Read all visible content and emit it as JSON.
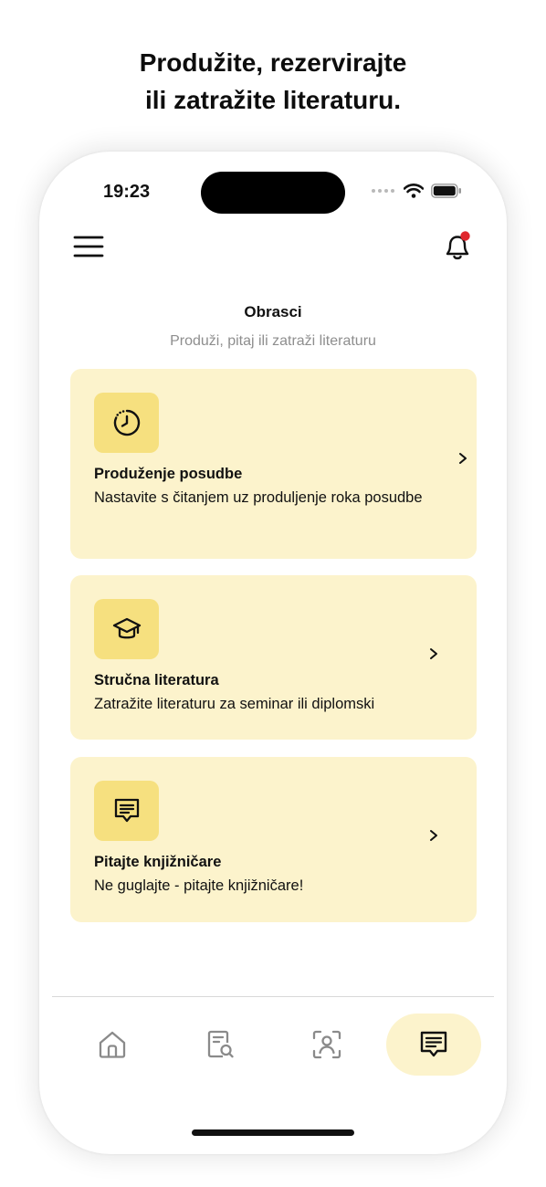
{
  "headline": {
    "line1": "Produžite, rezervirajte",
    "line2": "ili zatražite literaturu."
  },
  "status_bar": {
    "time": "19:23"
  },
  "header": {
    "menu_icon": "hamburger-menu-icon",
    "notification_icon": "bell-icon",
    "notification_badge_color": "#e0272d"
  },
  "page": {
    "title": "Obrasci",
    "subtitle": "Produži, pitaj ili zatraži literaturu"
  },
  "cards": [
    {
      "icon": "timer-clock-icon",
      "title": "Produženje posudbe",
      "description": "Nastavite s čitanjem uz produljenje roka posudbe"
    },
    {
      "icon": "graduation-cap-icon",
      "title": "Stručna literatura",
      "description": "Zatražite literaturu za seminar ili diplomski"
    },
    {
      "icon": "message-icon",
      "title": "Pitajte knjižničare",
      "description": "Ne guglajte - pitajte knjižničare!"
    }
  ],
  "tab_bar": {
    "items": [
      {
        "icon": "home-icon",
        "active": false
      },
      {
        "icon": "document-search-icon",
        "active": false
      },
      {
        "icon": "scan-user-icon",
        "active": false
      },
      {
        "icon": "message-icon",
        "active": true
      }
    ]
  },
  "colors": {
    "card_background": "#fcf3cc",
    "icon_background": "#f6e07f",
    "accent": "#f6e07f",
    "badge": "#e0272d"
  }
}
